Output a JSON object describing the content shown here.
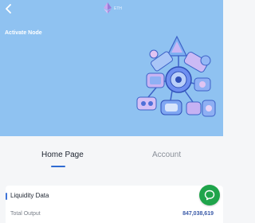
{
  "header": {
    "back_icon": "chevron-left-icon",
    "network_icon": "ethereum-icon",
    "network_label": "ETH",
    "title": "Activate Node"
  },
  "tabs": [
    {
      "label": "Home Page",
      "active": true
    },
    {
      "label": "Account",
      "active": false
    }
  ],
  "liquidity": {
    "title": "Liquidity Data",
    "rows": [
      {
        "label": "Total Output",
        "value": "847,038,619"
      }
    ]
  },
  "chat": {
    "icon": "chat-bubble-icon"
  },
  "colors": {
    "hero_bg": "#8fc2f1",
    "accent": "#2f6bd2",
    "chat_green": "#1fa44b"
  }
}
